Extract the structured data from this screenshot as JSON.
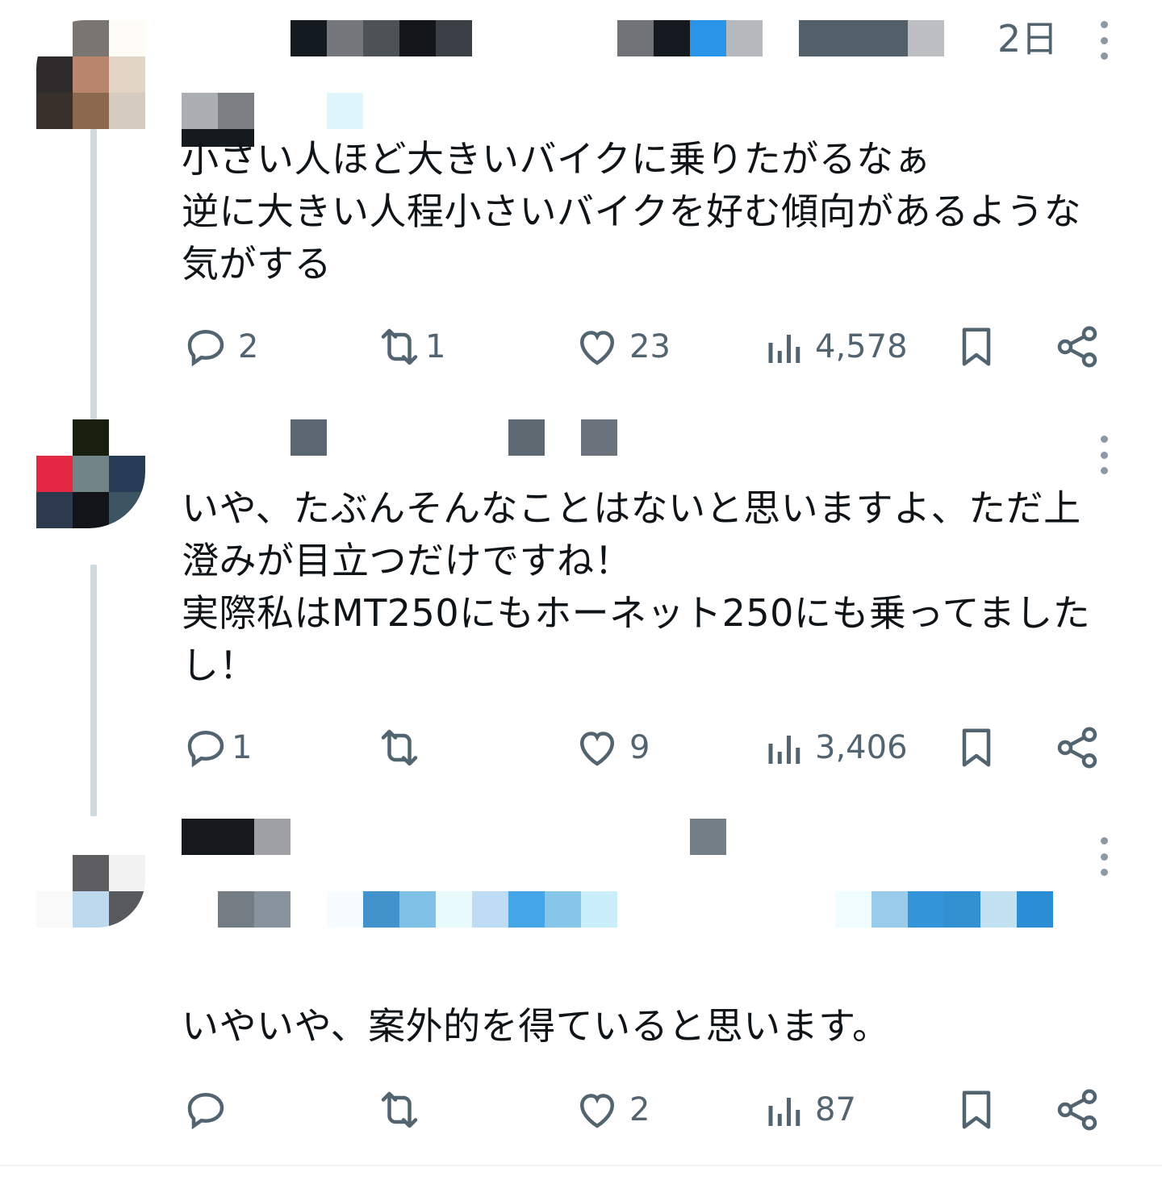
{
  "colors": {
    "text": "#0f1419",
    "secondary": "#536471",
    "thread_line": "#cfd9de",
    "icon": "#536471"
  },
  "tweets": [
    {
      "timestamp": "2日",
      "text": "小さい人ほど大きいバイクに乗りたがるなぁ\n逆に大きい人程小さいバイクを好む傾向があるような\n気がする",
      "actions": {
        "reply": "2",
        "retweet": "1",
        "like": "23",
        "views": "4,578"
      }
    },
    {
      "timestamp": "",
      "text": "いや、たぶんそんなことはないと思いますよ、ただ上\n澄みが目立つだけですね！\n実際私はMT250にもホーネット250にも乗ってました\nし！",
      "actions": {
        "reply": "1",
        "retweet": "",
        "like": "9",
        "views": "3,406"
      }
    },
    {
      "timestamp": "",
      "text": "いやいや、案外的を得ていると思います。",
      "actions": {
        "reply": "",
        "retweet": "",
        "like": "2",
        "views": "87"
      }
    }
  ],
  "icons": {
    "reply": "reply-icon",
    "retweet": "retweet-icon",
    "like": "heart-icon",
    "views": "views-icon",
    "bookmark": "bookmark-icon",
    "share": "share-icon",
    "more": "more-icon"
  }
}
